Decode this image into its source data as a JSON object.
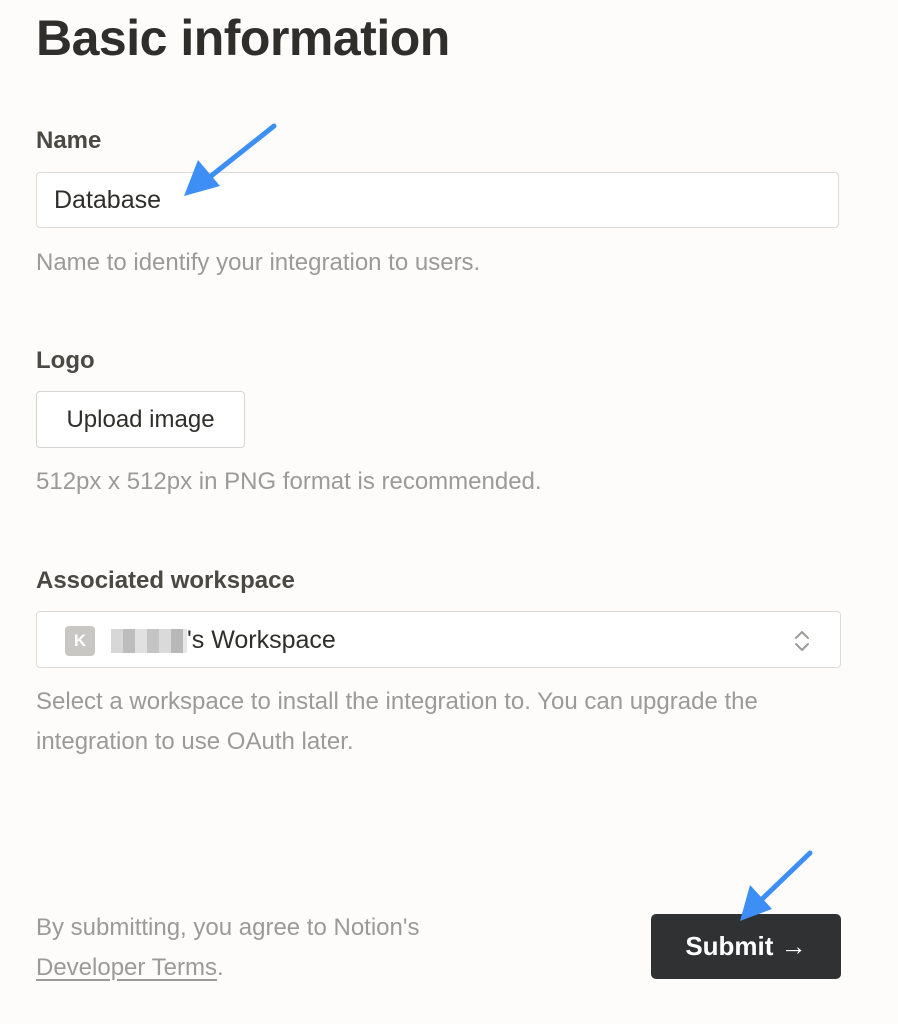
{
  "page": {
    "title": "Basic information"
  },
  "name_field": {
    "label": "Name",
    "value": "Database",
    "help": "Name to identify your integration to users."
  },
  "logo": {
    "label": "Logo",
    "upload_label": "Upload image",
    "help": "512px x 512px in PNG format is recommended."
  },
  "workspace": {
    "label": "Associated workspace",
    "avatar_letter": "K",
    "selected_suffix": "'s Workspace",
    "help": "Select a workspace to install the integration to. You can upgrade the integration to use OAuth later."
  },
  "footer": {
    "terms_prefix": "By submitting, you agree to Notion's",
    "terms_link": "Developer Terms",
    "terms_suffix": ".",
    "submit_label": "Submit →"
  },
  "colors": {
    "annotation_arrow": "#3d8ef5",
    "submit_bg": "#2f3133",
    "page_bg": "#fdfcfb"
  },
  "icons": {
    "select_chevrons": "chevron-up-down-icon",
    "annotation": "arrow-annotation-icon"
  }
}
